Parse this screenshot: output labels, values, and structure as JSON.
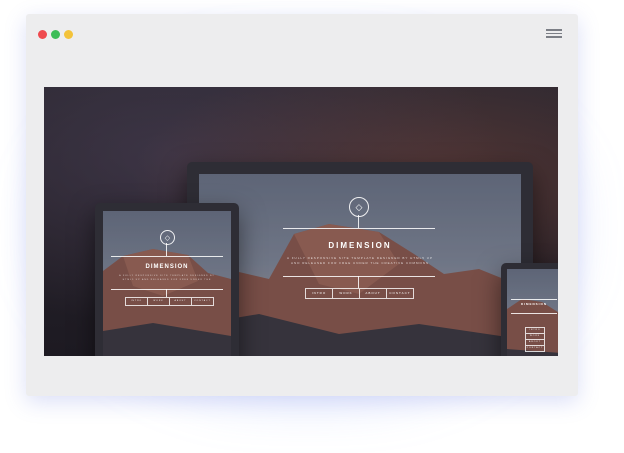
{
  "window": {
    "controls": [
      {
        "name": "close",
        "color": "#ef4a4e"
      },
      {
        "name": "minimize",
        "color": "#3dbd58"
      },
      {
        "name": "zoom",
        "color": "#f3c33a"
      }
    ],
    "menu_icon": "hamburger-menu-icon"
  },
  "hero": {
    "site_title": "DIMENSION",
    "logo_icon": "diamond-icon",
    "tagline": "A FULLY RESPONSIVE SITE TEMPLATE DESIGNED BY HTML5 UP AND RELEASED FOR FREE UNDER THE CREATIVE COMMONS LICENSE.",
    "nav": [
      "INTRO",
      "WORK",
      "ABOUT",
      "CONTACT"
    ]
  }
}
